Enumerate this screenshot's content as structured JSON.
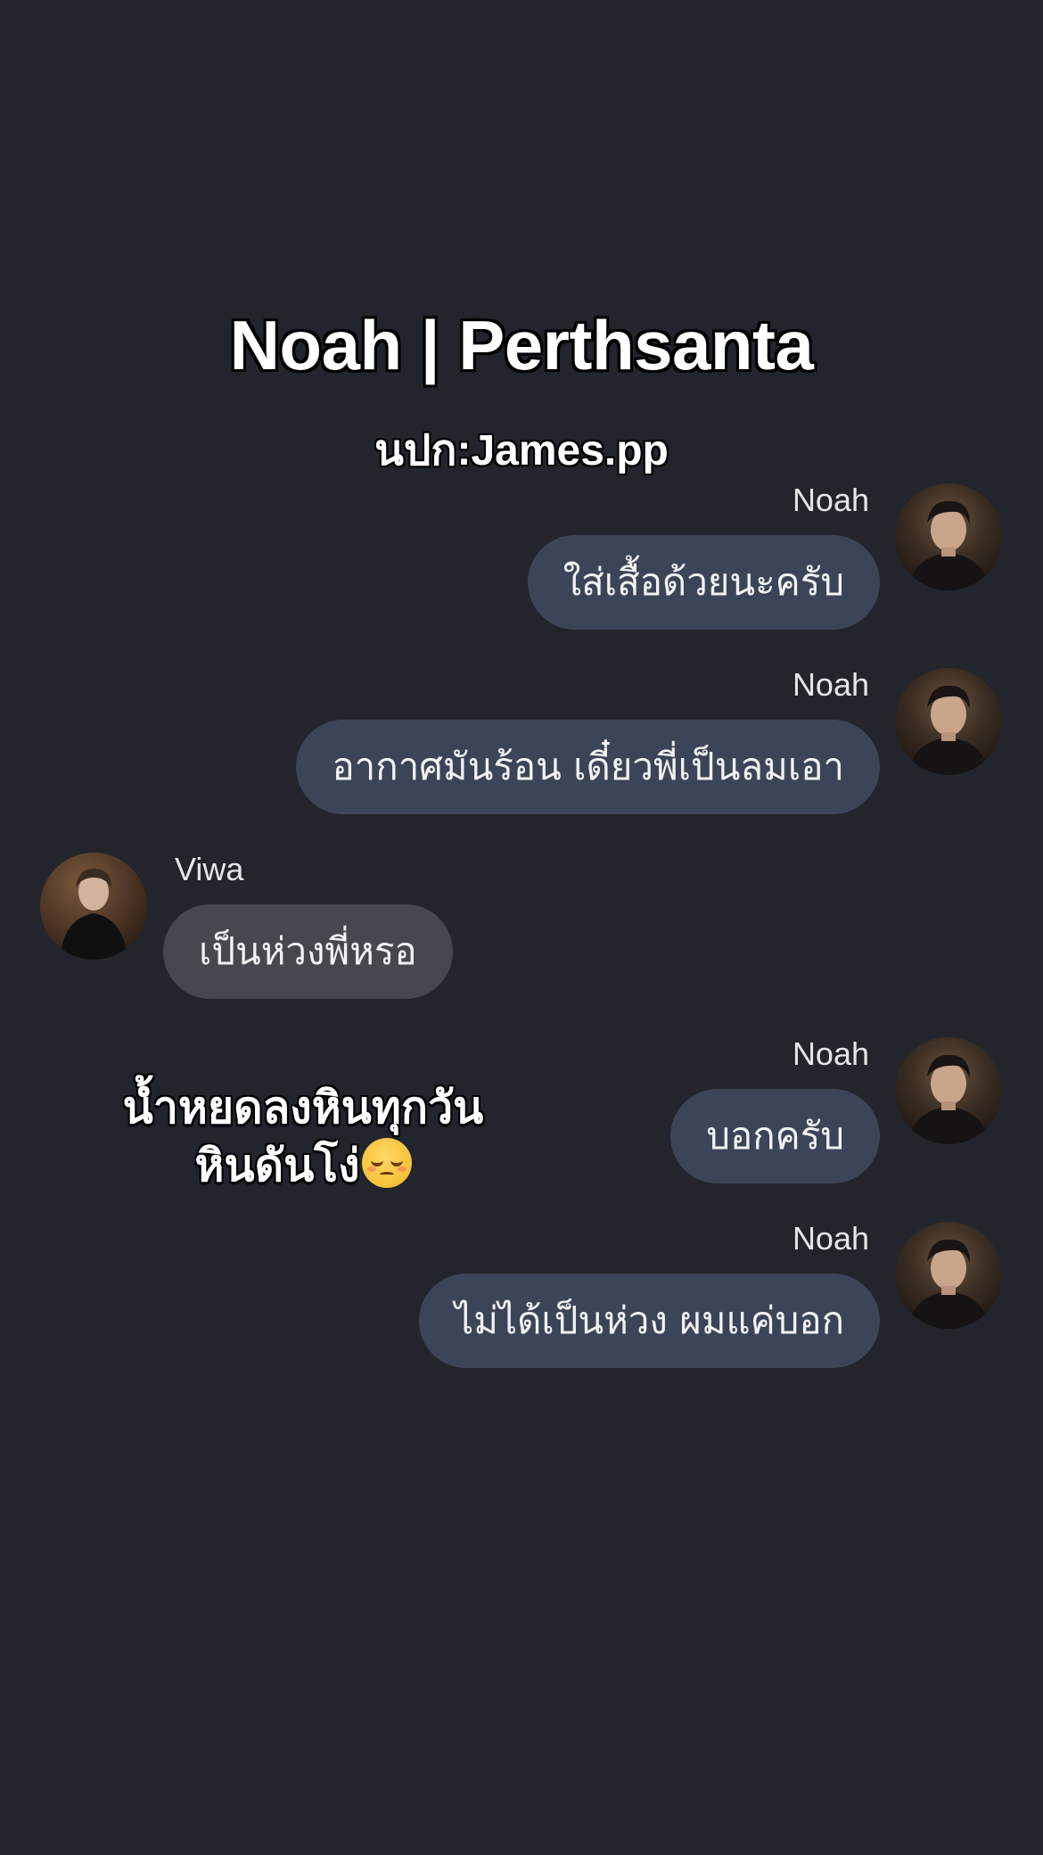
{
  "header": {
    "title": "Noah | Perthsanta",
    "subtitle": "นปก:James.pp"
  },
  "messages": [
    {
      "sender": "Noah",
      "text": "ใส่เสื้อด้วยนะครับ",
      "side": "right",
      "avatar_icon": "noah-avatar"
    },
    {
      "sender": "Noah",
      "text": "อากาศมันร้อน เดี๋ยวพี่เป็นลมเอา",
      "side": "right",
      "avatar_icon": "noah-avatar"
    },
    {
      "sender": "Viwa",
      "text": "เป็นห่วงพี่หรอ",
      "side": "left",
      "avatar_icon": "viwa-avatar"
    },
    {
      "sender": "Noah",
      "text": "บอกครับ",
      "side": "right",
      "avatar_icon": "noah-avatar"
    },
    {
      "sender": "Noah",
      "text": "ไม่ได้เป็นห่วง ผมแค่บอก",
      "side": "right",
      "avatar_icon": "noah-avatar"
    }
  ],
  "caption": {
    "line1": "น้ำหยดลงหินทุกวัน",
    "line2": "หินดันโง่",
    "emoji_icon": "pensive-face-emoji"
  },
  "colors": {
    "background": "#22252c",
    "outgoing_bubble": "#3c4557",
    "incoming_bubble": "#464850",
    "text": "#f2f2f4"
  }
}
